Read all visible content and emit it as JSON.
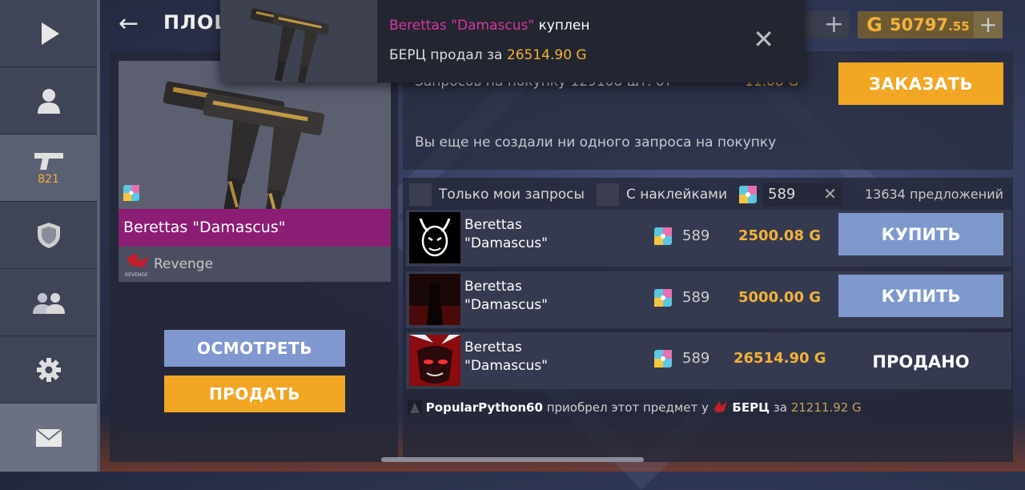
{
  "header": {
    "title": "ПЛОЩА",
    "currency_partial": "0",
    "gold_icon": "G",
    "gold_int": "50797",
    "gold_dec": ".55",
    "plus": "+"
  },
  "sidebar": {
    "items": [
      {
        "icon": "play-icon"
      },
      {
        "icon": "profile-icon"
      },
      {
        "icon": "pistol-icon",
        "count": "821"
      },
      {
        "icon": "shield-icon"
      },
      {
        "icon": "friends-icon"
      },
      {
        "icon": "gear-icon"
      },
      {
        "icon": "mail-icon"
      }
    ]
  },
  "item": {
    "name": "Berettas \"Damascus\"",
    "clan": "Revenge",
    "clan_logo_text": "REVENGE",
    "view_button": "ОСМОТРЕТЬ",
    "sell_button": "ПРОДАТЬ"
  },
  "orders": {
    "line": "Запросов на покупку 129108 шт. от",
    "price": "11.08 G",
    "order_button": "ЗАКАЗАТЬ",
    "empty_text": "Вы еще не создали ни одного запроса на покупку"
  },
  "filters": {
    "my_requests": "Только мои запросы",
    "with_stickers": "С наклейками",
    "search_value": "589",
    "clear": "✕",
    "offers_count": "13634 предложений"
  },
  "offers": [
    {
      "name_1": "Berettas",
      "name_2": "\"Damascus\"",
      "sticker": "589",
      "price": "2500.08 G",
      "action": "КУПИТЬ",
      "avatar": "devil-avatar"
    },
    {
      "name_1": "Berettas",
      "name_2": "\"Damascus\"",
      "sticker": "589",
      "price": "5000.00 G",
      "action": "КУПИТЬ",
      "avatar": "dark-figure-avatar"
    },
    {
      "name_1": "Berettas",
      "name_2": "\"Damascus\"",
      "sticker": "589",
      "price": "26514.90 G",
      "action": "ПРОДАНО",
      "avatar": "red-anime-avatar"
    }
  ],
  "history": {
    "buyer": "PopularPython60",
    "text": "приобрел этот предмет у",
    "seller": "БЕРЦ",
    "for_word": "за",
    "price": "21211.92 G"
  },
  "toast": {
    "item_name": "Berettas \"Damascus\"",
    "bought_word": "куплен",
    "seller": "БЕРЦ",
    "sold_for": "продал за",
    "amount": "26514.90 G",
    "close": "✕"
  },
  "colors": {
    "accent_gold": "#f3b23a",
    "buy_blue": "#7f98cc",
    "order_orange": "#f1a624",
    "item_magenta": "#8b1e74"
  }
}
